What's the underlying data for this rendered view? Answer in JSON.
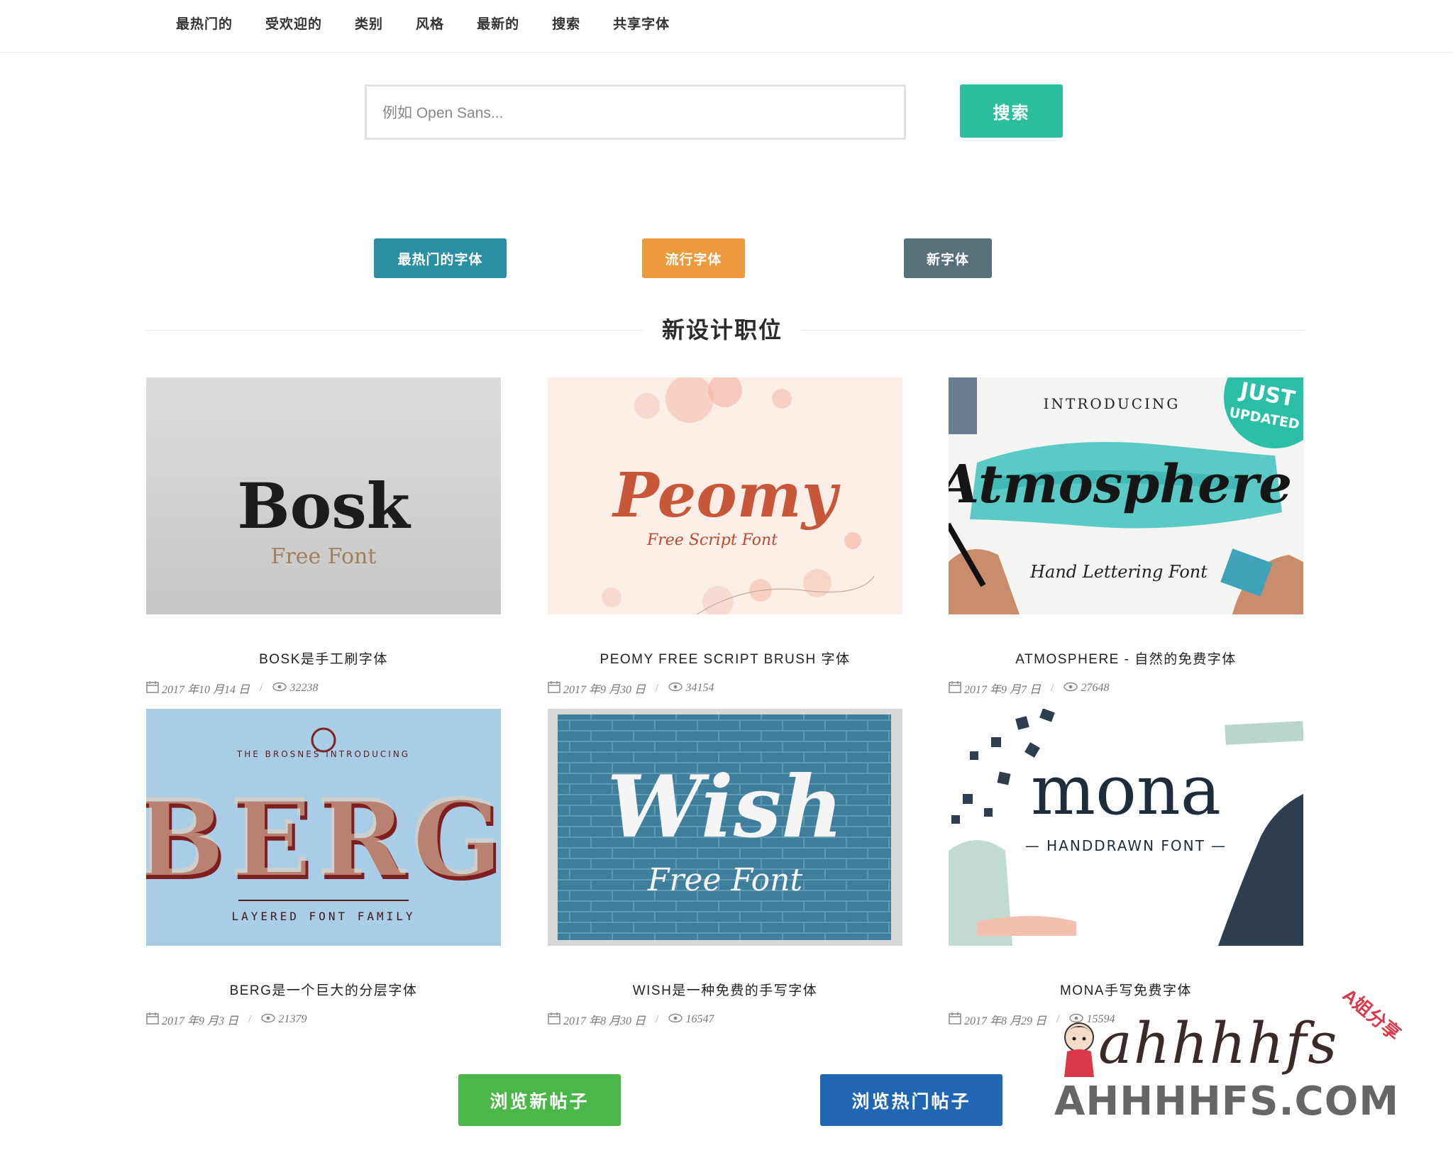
{
  "nav": {
    "items": [
      "最热门的",
      "受欢迎的",
      "类别",
      "风格",
      "最新的",
      "搜索",
      "共享字体"
    ]
  },
  "search": {
    "placeholder": "例如 Open Sans...",
    "button_label": "搜索"
  },
  "categories": {
    "hot_label": "最热门的字体",
    "popular_label": "流行字体",
    "new_label": "新字体"
  },
  "section": {
    "title": "新设计职位"
  },
  "cards": [
    {
      "title": "BOSK是手工刷字体",
      "date": "2017 年10 月14 日",
      "views": "32238",
      "image_text": "Bosk",
      "image_subtext": "Free Font"
    },
    {
      "title": "PEOMY FREE SCRIPT BRUSH 字体",
      "date": "2017 年9 月30 日",
      "views": "34154",
      "image_text": "Peomy",
      "image_subtext": "Free Script Font"
    },
    {
      "title": "ATMOSPHERE - 自然的免费字体",
      "date": "2017 年9 月7 日",
      "views": "27648",
      "image_text": "Atmosphere",
      "image_subtext": "Hand Lettering Font",
      "image_top": "INTRODUCING",
      "badge_line1": "JUST",
      "badge_line2": "UPDATED"
    },
    {
      "title": "BERG是一个巨大的分层字体",
      "date": "2017 年9 月3 日",
      "views": "21379",
      "image_text": "BERG",
      "image_subtext": "LAYERED FONT FAMILY",
      "image_top": "THE BROSNES INTRODUCING"
    },
    {
      "title": "WISH是一种免费的手写字体",
      "date": "2017 年8 月30 日",
      "views": "16547",
      "image_text": "Wish",
      "image_subtext": "Free Font"
    },
    {
      "title": "MONA手写免费字体",
      "date": "2017 年8 月29 日",
      "views": "15594",
      "image_text": "mona",
      "image_subtext": "— HANDDRAWN FONT —"
    }
  ],
  "bottom": {
    "new_posts_label": "浏览新帖子",
    "hot_posts_label": "浏览热门帖子"
  },
  "watermark": {
    "script": "ahhhhfs",
    "tag": "A姐分享",
    "url": "AHHHHFS.COM"
  },
  "colors": {
    "teal": "#2bbf9e",
    "hot": "#2a8fa4",
    "popular": "#ed9a3f",
    "new": "#57707a",
    "green": "#4cb749",
    "blue": "#2166b3"
  }
}
